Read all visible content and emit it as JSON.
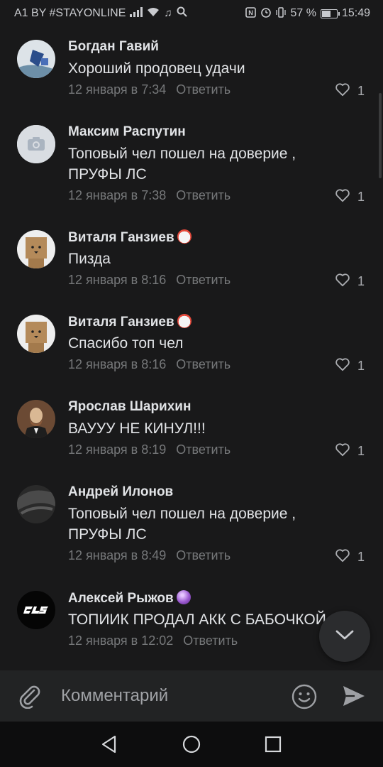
{
  "status": {
    "carrier": "A1 BY #STAYONLINE",
    "battery_percent": "57 %",
    "battery_level": 0.57,
    "time": "15:49"
  },
  "comments": [
    {
      "name": "Богдан Гавий",
      "lines": [
        "Хороший продовец удачи"
      ],
      "date": "12 января в 7:34",
      "reply": "Ответить",
      "likes": "1",
      "emoji": null
    },
    {
      "name": "Максим Распутин",
      "lines": [
        "Топовый чел пошел на доверие ,",
        "ПРУФЫ ЛС"
      ],
      "date": "12 января в 7:38",
      "reply": "Ответить",
      "likes": "1",
      "emoji": null
    },
    {
      "name": "Виталя Ганзиев",
      "lines": [
        "Пизда"
      ],
      "date": "12 января в 8:16",
      "reply": "Ответить",
      "likes": "1",
      "emoji": "clown-face-emoji"
    },
    {
      "name": "Виталя Ганзиев",
      "lines": [
        "Спасибо топ чел"
      ],
      "date": "12 января в 8:16",
      "reply": "Ответить",
      "likes": "1",
      "emoji": "clown-face-emoji"
    },
    {
      "name": "Ярослав Шарихин",
      "lines": [
        "ВАУУУ НЕ КИНУЛ!!!"
      ],
      "date": "12 января в 8:19",
      "reply": "Ответить",
      "likes": "1",
      "emoji": null
    },
    {
      "name": "Андрей Илонов",
      "lines": [
        "Топовый чел пошел на доверие ,",
        "ПРУФЫ ЛС"
      ],
      "date": "12 января в 8:49",
      "reply": "Ответить",
      "likes": "1",
      "emoji": null
    },
    {
      "name": "Алексей Рыжов",
      "lines": [
        "ТОПИИК ПРОДАЛ АКК С БАБОЧКОЙ"
      ],
      "date": "12 января в 12:02",
      "reply": "Ответить",
      "likes": "",
      "emoji": "crystal-ball-emoji"
    }
  ],
  "input": {
    "placeholder": "Комментарий"
  },
  "colors": {
    "background": "#19191a",
    "text": "#e1e3e6",
    "secondary": "#76787a"
  }
}
